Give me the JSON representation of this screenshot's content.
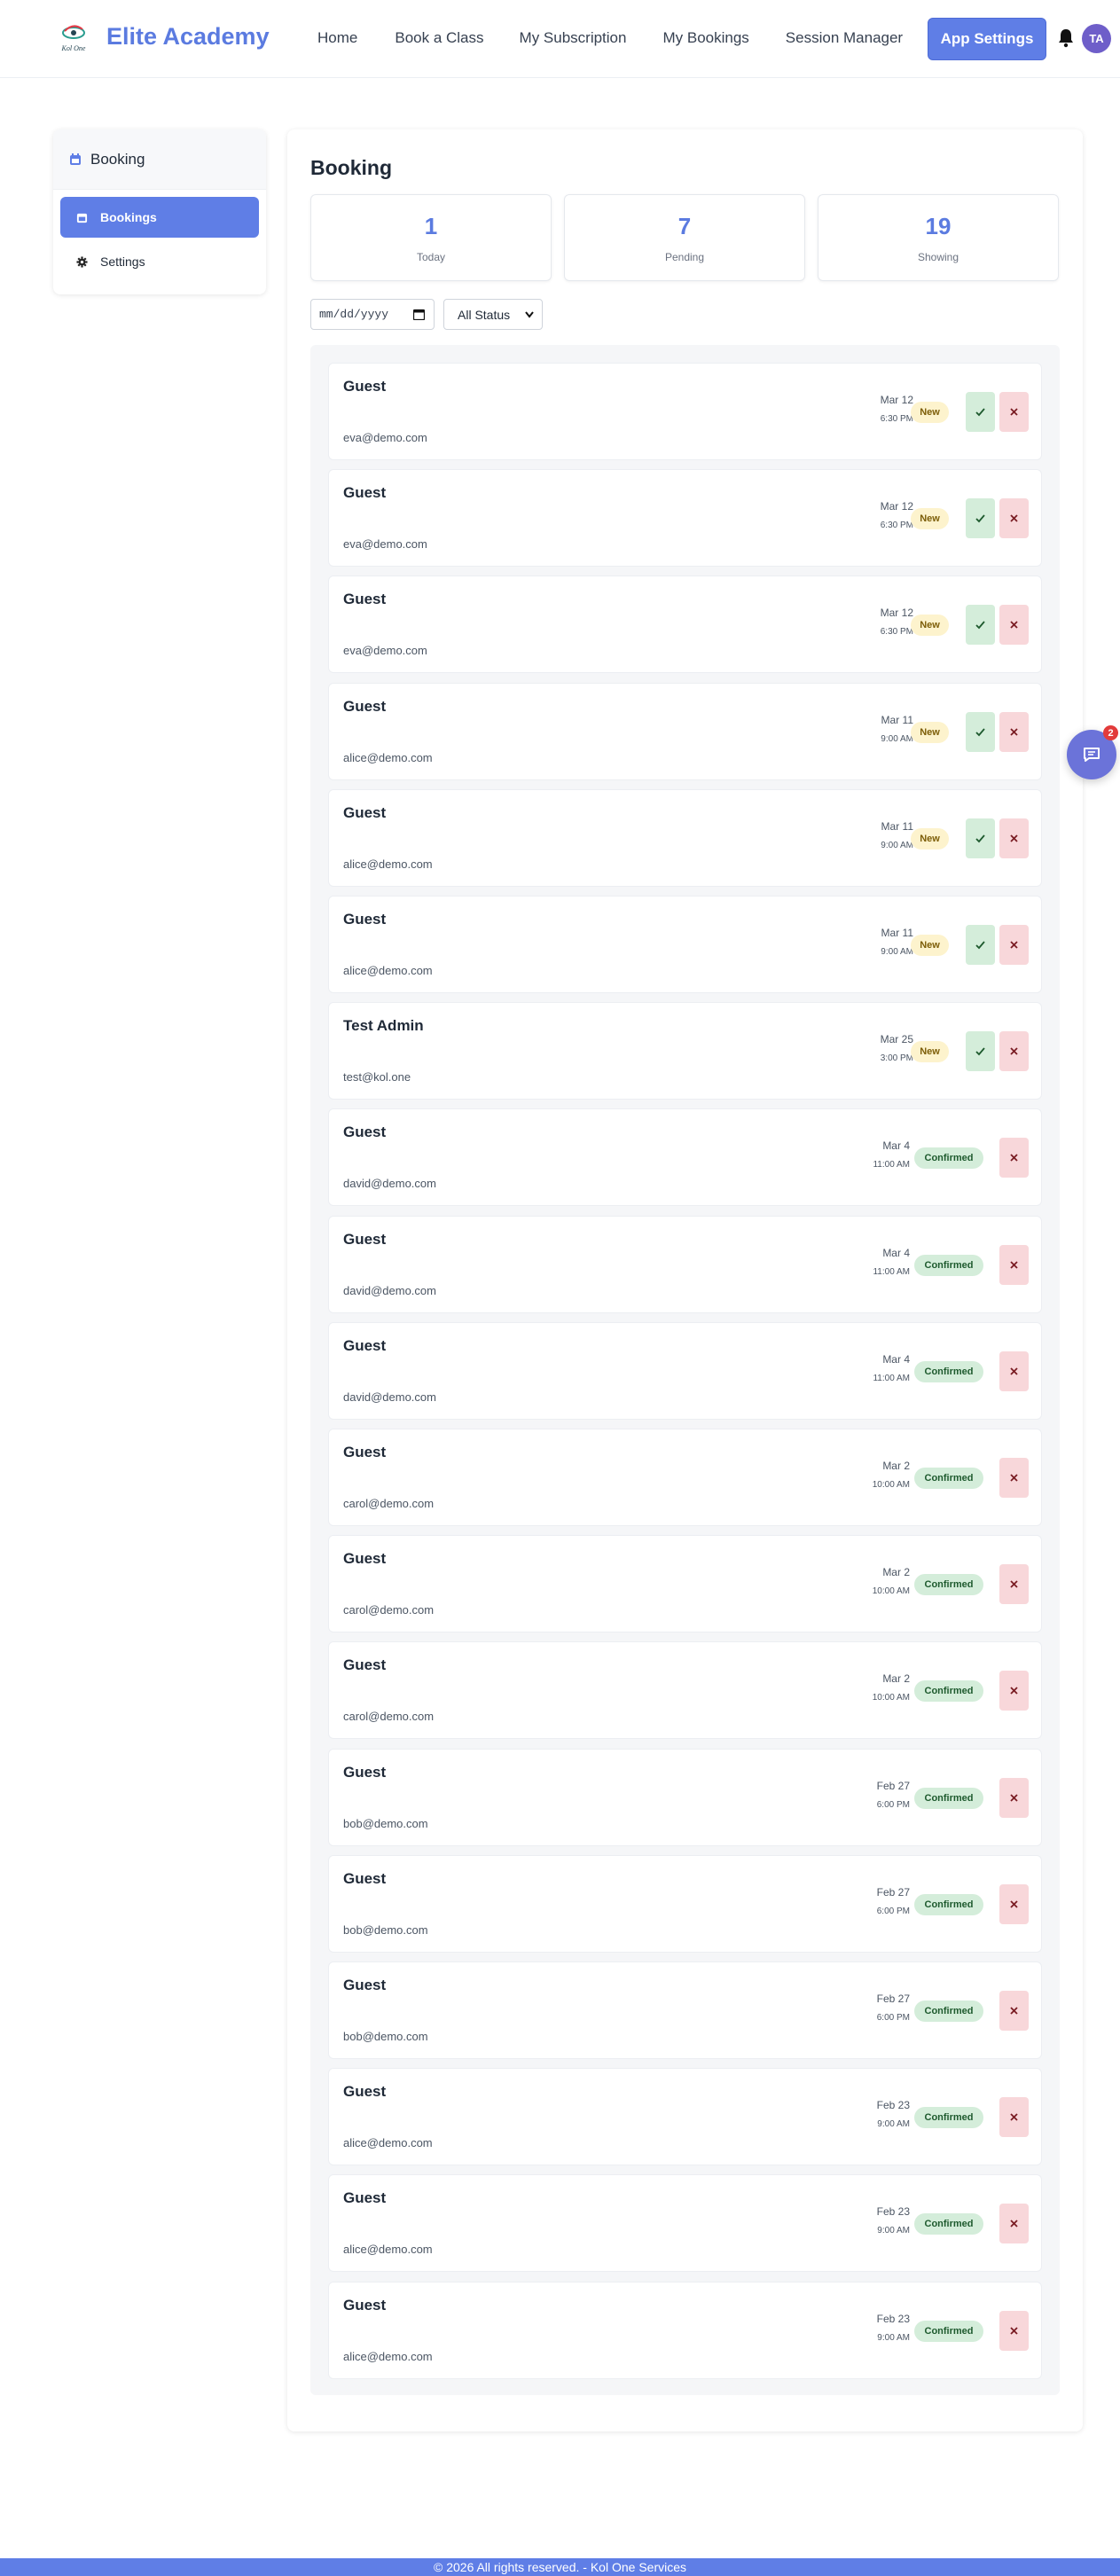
{
  "header": {
    "brand": "Elite Academy",
    "logo_text": "Kol One",
    "nav": [
      "Home",
      "Book a Class",
      "My Subscription",
      "My Bookings",
      "Session Manager"
    ],
    "app_settings": "App Settings",
    "avatar_initials": "TA"
  },
  "sidebar": {
    "title": "Booking",
    "items": [
      {
        "label": "Bookings",
        "active": true,
        "icon": "calendar-icon"
      },
      {
        "label": "Settings",
        "active": false,
        "icon": "gear-icon"
      }
    ]
  },
  "main": {
    "title": "Booking",
    "stats": [
      {
        "value": "1",
        "label": "Today"
      },
      {
        "value": "7",
        "label": "Pending"
      },
      {
        "value": "19",
        "label": "Showing"
      }
    ],
    "date_placeholder": "mm/dd/yyyy",
    "status_filter": "All Status"
  },
  "bookings": [
    {
      "name": "Guest",
      "email": "eva@demo.com",
      "date": "Mar 12",
      "time": "6:30 PM",
      "status": "New"
    },
    {
      "name": "Guest",
      "email": "eva@demo.com",
      "date": "Mar 12",
      "time": "6:30 PM",
      "status": "New"
    },
    {
      "name": "Guest",
      "email": "eva@demo.com",
      "date": "Mar 12",
      "time": "6:30 PM",
      "status": "New"
    },
    {
      "name": "Guest",
      "email": "alice@demo.com",
      "date": "Mar 11",
      "time": "9:00 AM",
      "status": "New"
    },
    {
      "name": "Guest",
      "email": "alice@demo.com",
      "date": "Mar 11",
      "time": "9:00 AM",
      "status": "New"
    },
    {
      "name": "Guest",
      "email": "alice@demo.com",
      "date": "Mar 11",
      "time": "9:00 AM",
      "status": "New"
    },
    {
      "name": "Test Admin",
      "email": "test@kol.one",
      "date": "Mar 25",
      "time": "3:00 PM",
      "status": "New"
    },
    {
      "name": "Guest",
      "email": "david@demo.com",
      "date": "Mar 4",
      "time": "11:00 AM",
      "status": "Confirmed"
    },
    {
      "name": "Guest",
      "email": "david@demo.com",
      "date": "Mar 4",
      "time": "11:00 AM",
      "status": "Confirmed"
    },
    {
      "name": "Guest",
      "email": "david@demo.com",
      "date": "Mar 4",
      "time": "11:00 AM",
      "status": "Confirmed"
    },
    {
      "name": "Guest",
      "email": "carol@demo.com",
      "date": "Mar 2",
      "time": "10:00 AM",
      "status": "Confirmed"
    },
    {
      "name": "Guest",
      "email": "carol@demo.com",
      "date": "Mar 2",
      "time": "10:00 AM",
      "status": "Confirmed"
    },
    {
      "name": "Guest",
      "email": "carol@demo.com",
      "date": "Mar 2",
      "time": "10:00 AM",
      "status": "Confirmed"
    },
    {
      "name": "Guest",
      "email": "bob@demo.com",
      "date": "Feb 27",
      "time": "6:00 PM",
      "status": "Confirmed"
    },
    {
      "name": "Guest",
      "email": "bob@demo.com",
      "date": "Feb 27",
      "time": "6:00 PM",
      "status": "Confirmed"
    },
    {
      "name": "Guest",
      "email": "bob@demo.com",
      "date": "Feb 27",
      "time": "6:00 PM",
      "status": "Confirmed"
    },
    {
      "name": "Guest",
      "email": "alice@demo.com",
      "date": "Feb 23",
      "time": "9:00 AM",
      "status": "Confirmed"
    },
    {
      "name": "Guest",
      "email": "alice@demo.com",
      "date": "Feb 23",
      "time": "9:00 AM",
      "status": "Confirmed"
    },
    {
      "name": "Guest",
      "email": "alice@demo.com",
      "date": "Feb 23",
      "time": "9:00 AM",
      "status": "Confirmed"
    }
  ],
  "chat": {
    "badge": "2",
    "icon": "chat-icon"
  },
  "footer": {
    "text": "© 2026 All rights reserved. - Kol One Services"
  },
  "colors": {
    "accent": "#5f7ee6",
    "new_badge": "#fdf3cd",
    "confirmed_badge": "#d4edda",
    "reject": "#f8d7da"
  }
}
